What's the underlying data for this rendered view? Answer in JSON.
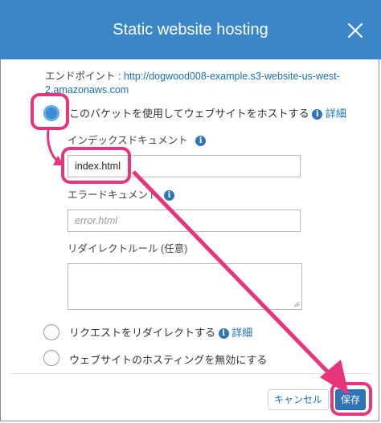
{
  "dialog": {
    "title": "Static website hosting",
    "endpoint_label": "エンドポイント : ",
    "endpoint_url": "http://dogwood008-example.s3-website-us-west-2.amazonaws.com"
  },
  "options": {
    "host": {
      "label": "このバケットを使用してウェブサイトをホストする",
      "selected": true,
      "detail_link": "詳細"
    },
    "redirect": {
      "label": "リクエストをリダイレクトする",
      "selected": false,
      "detail_link": "詳細"
    },
    "disable": {
      "label": "ウェブサイトのホスティングを無効にする",
      "selected": false
    }
  },
  "fields": {
    "index_document": {
      "label": "インデックスドキュメント",
      "value": "index.html"
    },
    "error_document": {
      "label": "エラードキュメント",
      "placeholder": "error.html"
    },
    "redirect_rules": {
      "label": "リダイレクトルール (任意)",
      "value": ""
    }
  },
  "footer": {
    "cancel_label": "キャンセル",
    "save_label": "保存"
  },
  "icons": {
    "info": "info-icon",
    "close": "close-icon"
  },
  "colors": {
    "header": "#3b86c6",
    "annotation": "#e8347a",
    "primary_button": "#2f74b8",
    "link": "#1a6fb5"
  }
}
